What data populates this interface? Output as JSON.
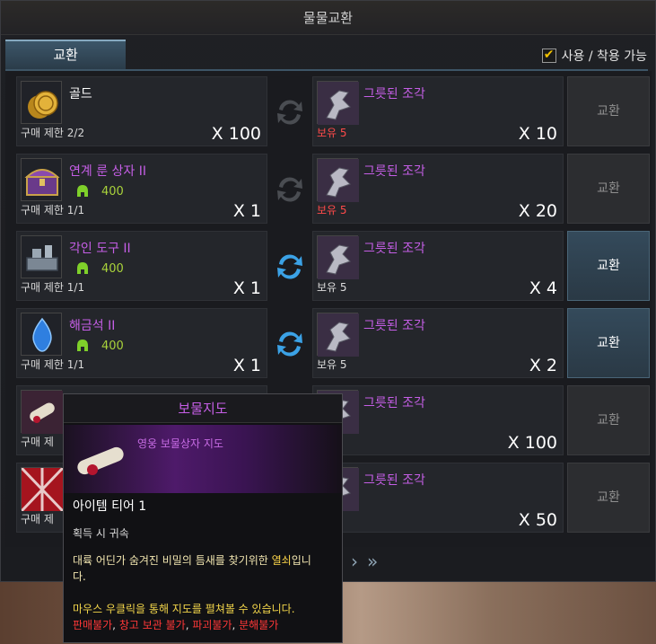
{
  "window": {
    "title": "물물교환"
  },
  "tab": {
    "label": "교환"
  },
  "filter": {
    "label": "사용 / 착용 가능",
    "checked": "✔"
  },
  "rows": [
    {
      "name": "골드",
      "name_color": "#ffffff",
      "cost_value": "",
      "limit": "구매 제한 2/2",
      "qty": "X 100",
      "out_name": "그릇된 조각",
      "own": "보유 5",
      "own_color": "#ff4a4a",
      "out_qty": "X 10",
      "button": "교환",
      "active": false
    },
    {
      "name": "연계 룬 상자 II",
      "name_color": "#c55ee6",
      "cost_value": "400",
      "limit": "구매 제한 1/1",
      "qty": "X 1",
      "out_name": "그릇된 조각",
      "own": "보유 5",
      "own_color": "#ff4a4a",
      "out_qty": "X 20",
      "button": "교환",
      "active": false
    },
    {
      "name": "각인 도구 II",
      "name_color": "#c55ee6",
      "cost_value": "400",
      "limit": "구매 제한 1/1",
      "qty": "X 1",
      "out_name": "그릇된 조각",
      "own": "보유 5",
      "own_color": "#dddddd",
      "out_qty": "X 4",
      "button": "교환",
      "active": true
    },
    {
      "name": "해금석 II",
      "name_color": "#c55ee6",
      "cost_value": "400",
      "limit": "구매 제한 1/1",
      "qty": "X 1",
      "out_name": "그릇된 조각",
      "own": "보유 5",
      "own_color": "#dddddd",
      "out_qty": "X 2",
      "button": "교환",
      "active": true
    },
    {
      "name": "",
      "name_color": "#c55ee6",
      "cost_value": "",
      "limit": "구매 제",
      "qty": "",
      "out_name": "그릇된 조각",
      "own": "",
      "own_color": "#ff4a4a",
      "out_qty": "X 100",
      "button": "교환",
      "active": false
    },
    {
      "name": "",
      "name_color": "#c55ee6",
      "cost_value": "",
      "limit": "구매 제",
      "qty": "",
      "out_name": "그릇된 조각",
      "own": "",
      "own_color": "#ff4a4a",
      "out_qty": "X 50",
      "button": "교환",
      "active": false
    }
  ],
  "pager": {
    "next": "›",
    "last": "»"
  },
  "tooltip": {
    "title": "보물지도",
    "grade": "영웅 보물상자 지도",
    "tier": "아이템 티어 1",
    "bind": "획득 시 귀속",
    "desc_a": "대륙 어딘가 숨겨진 비밀의 틈새를 찾기위한",
    "desc_key": "열쇠",
    "desc_b": "입니",
    "desc_c": "다.",
    "usage": "마우스 우클릭을 통해 지도를 펼쳐볼 수 있습니다.",
    "r1": "판매불가",
    "r2": "창고 보관 불가",
    "r3": "파괴불가",
    "r4": "분해불가",
    "sep": ", "
  }
}
